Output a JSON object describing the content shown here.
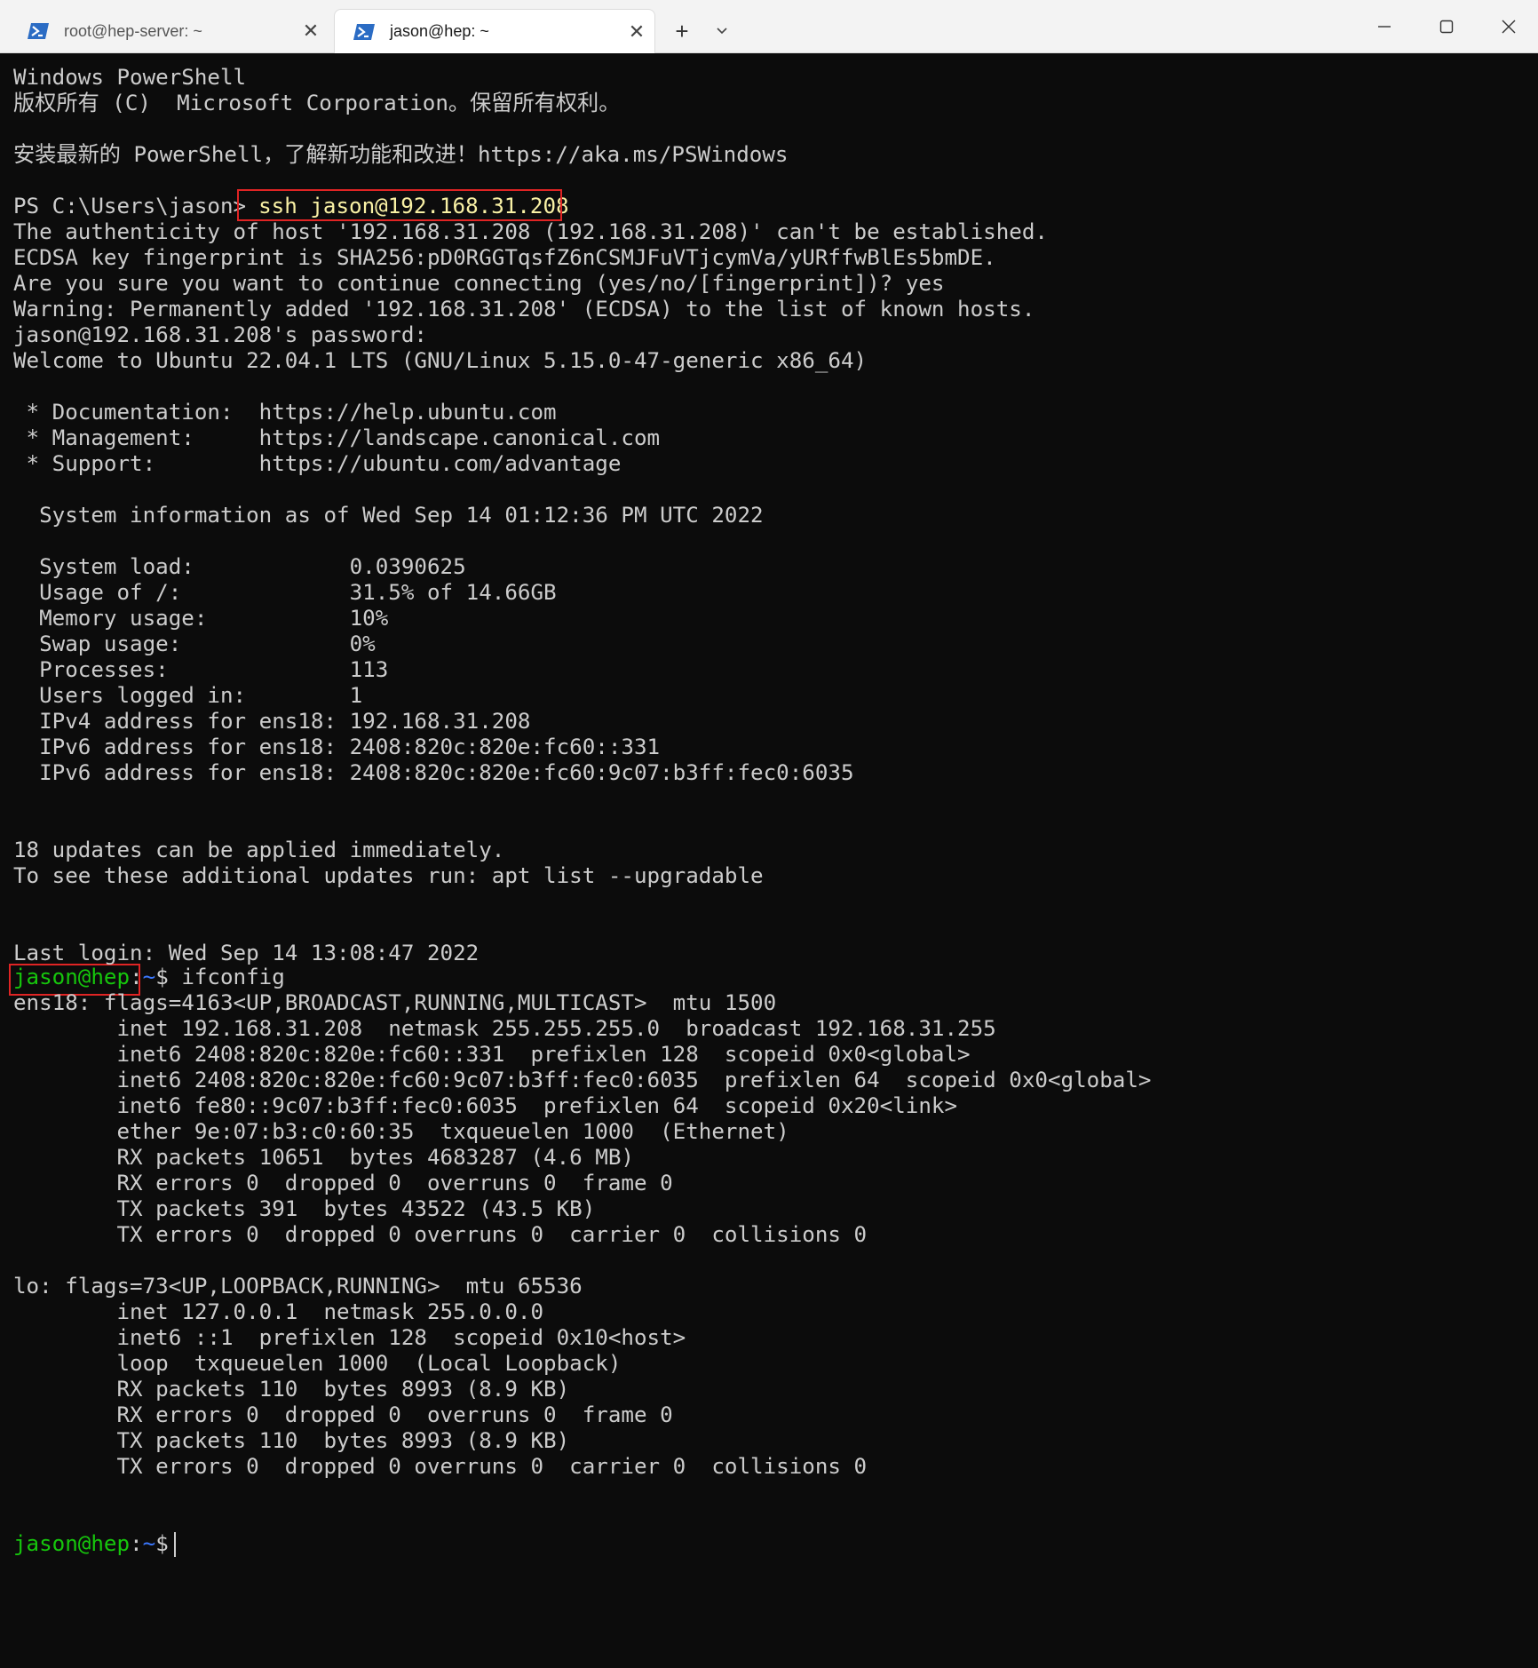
{
  "tabs": [
    {
      "title": "root@hep-server: ~",
      "active": false
    },
    {
      "title": "jason@hep: ~",
      "active": true
    }
  ],
  "tab_icon": "powershell-icon",
  "new_tab_label": "+",
  "colors": {
    "background": "#0c0c0c",
    "foreground": "#cccccc",
    "prompt_user": "#16c60c",
    "prompt_path": "#3b78ff",
    "command_highlight": "#f9f1a5",
    "annotation_box": "#e02424",
    "titlebar": "#f3f3f3"
  },
  "terminal": {
    "ps_header": [
      "Windows PowerShell",
      "版权所有 (C)  Microsoft Corporation。保留所有权利。",
      "",
      "安装最新的 PowerShell，了解新功能和改进！https://aka.ms/PSWindows",
      ""
    ],
    "ps_prompt": "PS C:\\Users\\jason>",
    "ssh_command": "ssh jason@192.168.31.208",
    "ssh_output": [
      "The authenticity of host '192.168.31.208 (192.168.31.208)' can't be established.",
      "ECDSA key fingerprint is SHA256:pD0RGGTqsfZ6nCSMJFuVTjcymVa/yURffwBlEs5bmDE.",
      "Are you sure you want to continue connecting (yes/no/[fingerprint])? yes",
      "Warning: Permanently added '192.168.31.208' (ECDSA) to the list of known hosts.",
      "jason@192.168.31.208's password:",
      "Welcome to Ubuntu 22.04.1 LTS (GNU/Linux 5.15.0-47-generic x86_64)",
      "",
      " * Documentation:  https://help.ubuntu.com",
      " * Management:     https://landscape.canonical.com",
      " * Support:        https://ubuntu.com/advantage",
      "",
      "  System information as of Wed Sep 14 01:12:36 PM UTC 2022",
      "",
      "  System load:            0.0390625",
      "  Usage of /:             31.5% of 14.66GB",
      "  Memory usage:           10%",
      "  Swap usage:             0%",
      "  Processes:              113",
      "  Users logged in:        1",
      "  IPv4 address for ens18: 192.168.31.208",
      "  IPv6 address for ens18: 2408:820c:820e:fc60::331",
      "  IPv6 address for ens18: 2408:820c:820e:fc60:9c07:b3ff:fec0:6035",
      "",
      "",
      "18 updates can be applied immediately.",
      "To see these additional updates run: apt list --upgradable",
      "",
      "",
      "Last login: Wed Sep 14 13:08:47 2022"
    ],
    "bash_user": "jason@hep",
    "bash_colon": ":",
    "bash_path": "~",
    "bash_dollar": "$ ",
    "bash_command": "ifconfig",
    "ifconfig_output": [
      "ens18: flags=4163<UP,BROADCAST,RUNNING,MULTICAST>  mtu 1500",
      "        inet 192.168.31.208  netmask 255.255.255.0  broadcast 192.168.31.255",
      "        inet6 2408:820c:820e:fc60::331  prefixlen 128  scopeid 0x0<global>",
      "        inet6 2408:820c:820e:fc60:9c07:b3ff:fec0:6035  prefixlen 64  scopeid 0x0<global>",
      "        inet6 fe80::9c07:b3ff:fec0:6035  prefixlen 64  scopeid 0x20<link>",
      "        ether 9e:07:b3:c0:60:35  txqueuelen 1000  (Ethernet)",
      "        RX packets 10651  bytes 4683287 (4.6 MB)",
      "        RX errors 0  dropped 0  overruns 0  frame 0",
      "        TX packets 391  bytes 43522 (43.5 KB)",
      "        TX errors 0  dropped 0 overruns 0  carrier 0  collisions 0",
      "",
      "lo: flags=73<UP,LOOPBACK,RUNNING>  mtu 65536",
      "        inet 127.0.0.1  netmask 255.0.0.0",
      "        inet6 ::1  prefixlen 128  scopeid 0x10<host>",
      "        loop  txqueuelen 1000  (Local Loopback)",
      "        RX packets 110  bytes 8993 (8.9 KB)",
      "        RX errors 0  dropped 0  overruns 0  frame 0",
      "        TX packets 110  bytes 8993 (8.9 KB)",
      "        TX errors 0  dropped 0 overruns 0  carrier 0  collisions 0",
      ""
    ]
  }
}
